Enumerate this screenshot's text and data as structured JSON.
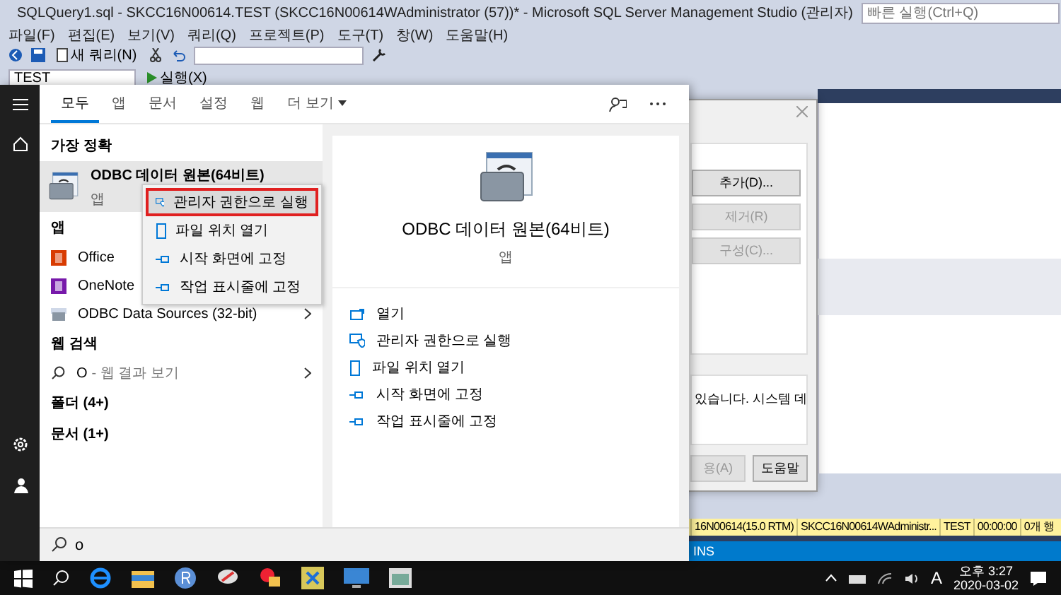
{
  "ssms": {
    "title": "SQLQuery1.sql - SKCC16N00614.TEST (SKCC16N00614WAdministrator (57))* - Microsoft SQL Server Management Studio (관리자)",
    "quick_launch": {
      "placeholder": "빠른 실행(Ctrl+Q)"
    },
    "menu": [
      "파일(F)",
      "편집(E)",
      "보기(V)",
      "쿼리(Q)",
      "프로젝트(P)",
      "도구(T)",
      "창(W)",
      "도움말(H)"
    ],
    "new_query": "새 쿼리(N)",
    "database": "TEST",
    "execute": "실행(X)",
    "status_bar": [
      "16N00614(15.0 RTM)",
      "SKCC16N00614WAdministr...",
      "TEST",
      "00:00:00",
      "0개 행"
    ],
    "mode": "INS"
  },
  "dialog": {
    "buttons": [
      {
        "label": "추가(D)...",
        "disabled": false
      },
      {
        "label": "제거(R)",
        "disabled": true
      },
      {
        "label": "구성(C)...",
        "disabled": true
      }
    ],
    "description": "있습니다. 시스템 데",
    "bottom_buttons": [
      {
        "label": "용(A)",
        "disabled": true
      },
      {
        "label": "도움말",
        "disabled": false
      }
    ]
  },
  "start_menu": {
    "tabs": [
      {
        "label": "모두",
        "selected": true
      },
      {
        "label": "앱",
        "selected": false
      },
      {
        "label": "문서",
        "selected": false
      },
      {
        "label": "설정",
        "selected": false
      },
      {
        "label": "웹",
        "selected": false
      },
      {
        "label": "더 보기",
        "selected": false
      }
    ],
    "best_match_heading": "가장 정확",
    "best_match": {
      "title": "ODBC 데이터 원본(64비트)",
      "subtitle": "앱",
      "selected": true
    },
    "context_menu": [
      {
        "label": "관리자 권한으로 실행",
        "kind": "admin",
        "selected": true
      },
      {
        "label": "파일 위치 열기",
        "kind": "folder",
        "selected": false
      },
      {
        "label": "시작 화면에 고정",
        "kind": "pin",
        "selected": false
      },
      {
        "label": "작업 표시줄에 고정",
        "kind": "pin",
        "selected": false
      }
    ],
    "apps_heading": "앱",
    "apps": [
      {
        "label": "Office",
        "kind": "office"
      },
      {
        "label": "OneNote",
        "kind": "onenote"
      },
      {
        "label": "ODBC Data Sources (32-bit)",
        "kind": "odbc"
      }
    ],
    "web_heading": "웹 검색",
    "web_result": {
      "query": "O",
      "label": "- 웹 결과 보기"
    },
    "folders": "폴더 (4+)",
    "documents": "문서 (1+)",
    "detail": {
      "title": "ODBC 데이터 원본(64비트)",
      "subtitle": "앱",
      "actions": [
        {
          "label": "열기",
          "kind": "open"
        },
        {
          "label": "관리자 권한으로 실행",
          "kind": "admin"
        },
        {
          "label": "파일 위치 열기",
          "kind": "folder"
        },
        {
          "label": "시작 화면에 고정",
          "kind": "pin"
        },
        {
          "label": "작업 표시줄에 고정",
          "kind": "pin"
        }
      ]
    },
    "search": {
      "value": "o"
    }
  },
  "taskbar": {
    "ime": "A",
    "time": "오후 3:27",
    "date": "2020-03-02"
  }
}
